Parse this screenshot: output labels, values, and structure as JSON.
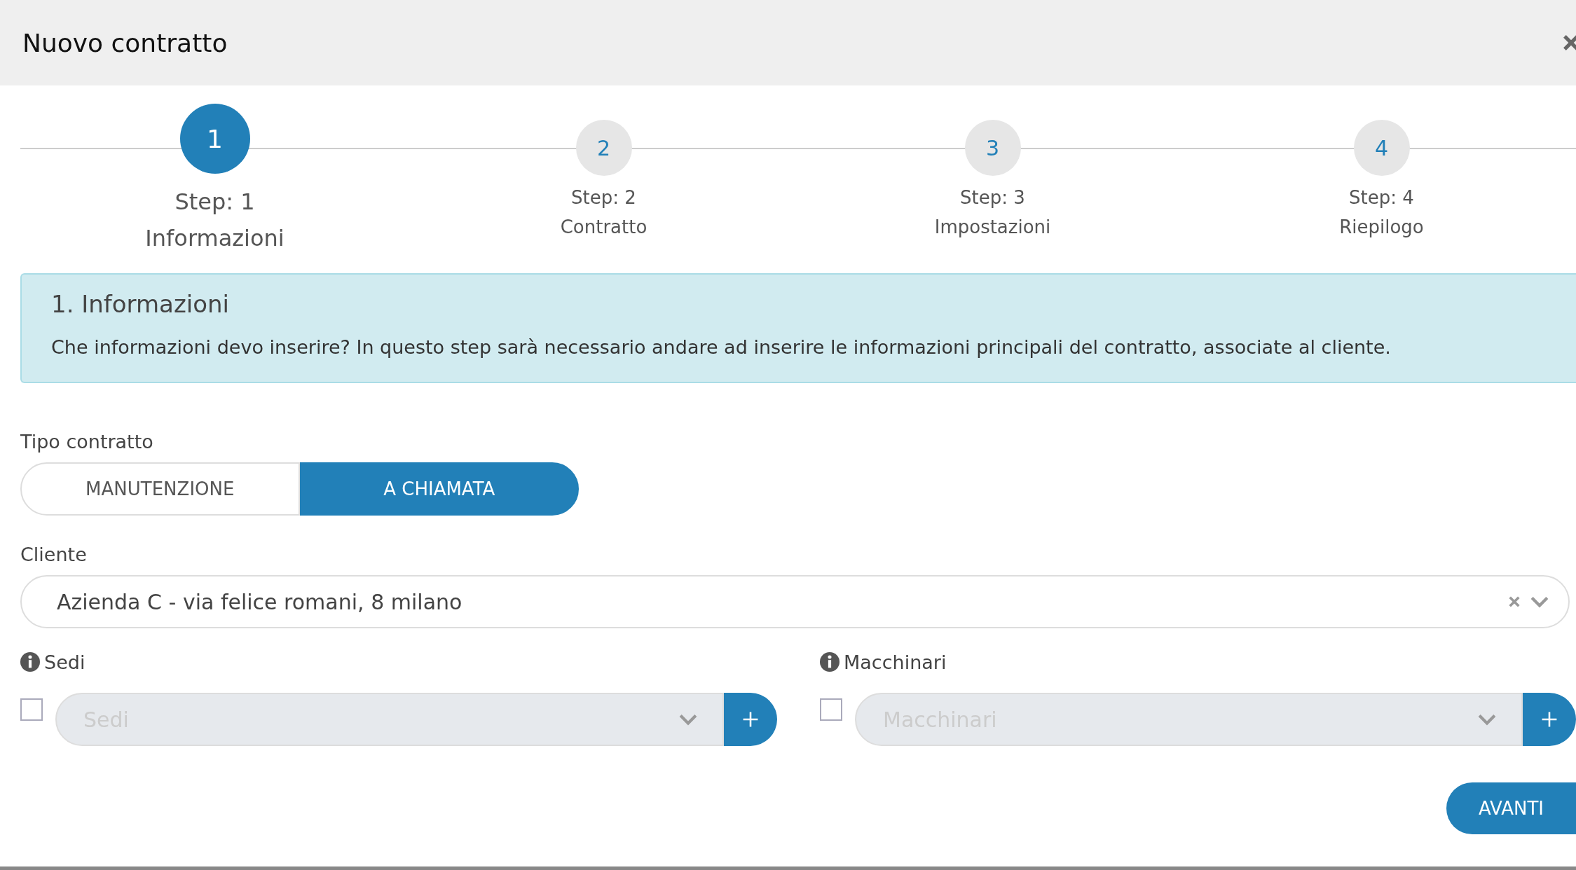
{
  "dialog": {
    "title": "Nuovo contratto"
  },
  "steps": [
    {
      "number": "1",
      "step": "Step: 1",
      "label": "Informazioni",
      "selected": true
    },
    {
      "number": "2",
      "step": "Step: 2",
      "label": "Contratto",
      "selected": false
    },
    {
      "number": "3",
      "step": "Step: 3",
      "label": "Impostazioni",
      "selected": false
    },
    {
      "number": "4",
      "step": "Step: 4",
      "label": "Riepilogo",
      "selected": false
    }
  ],
  "info": {
    "title": "1. Informazioni",
    "text": "Che informazioni devo inserire? In questo step sarà necessario andare ad inserire le informazioni principali del contratto, associate al cliente."
  },
  "tipo_contratto": {
    "label": "Tipo contratto",
    "options": [
      {
        "label": "MANUTENZIONE",
        "selected": false
      },
      {
        "label": "A CHIAMATA",
        "selected": true
      }
    ]
  },
  "cliente": {
    "label": "Cliente",
    "value": "Azienda C - via felice romani, 8 milano"
  },
  "selects": [
    {
      "label": "Sedi",
      "checked": false,
      "placeholder": "Sedi"
    },
    {
      "label": "Macchinari",
      "checked": false,
      "placeholder": "Macchinari"
    }
  ],
  "buttons": {
    "next": "AVANTI"
  }
}
